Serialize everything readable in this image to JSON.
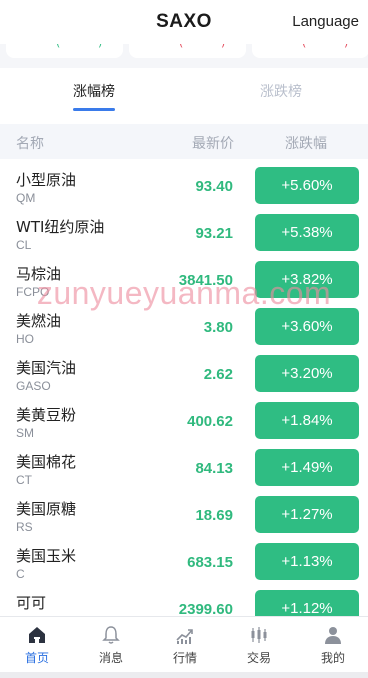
{
  "header": {
    "brand": "SAXO",
    "language_label": "Language"
  },
  "top_cards": [
    {
      "mark": "(",
      "mark_end": ")",
      "color": "#2fbd83"
    },
    {
      "mark": "(",
      "mark_end": ")",
      "color": "#e44b5c"
    },
    {
      "mark": "(",
      "mark_end": ")",
      "color": "#e44b5c"
    }
  ],
  "tabs": [
    {
      "label": "涨幅榜",
      "active": true
    },
    {
      "label": "涨跌榜",
      "active": false
    }
  ],
  "table": {
    "columns": {
      "name": "名称",
      "price": "最新价",
      "change": "涨跌幅"
    },
    "rows": [
      {
        "name": "小型原油",
        "code": "QM",
        "price": "93.40",
        "change": "+5.60%"
      },
      {
        "name": "WTI纽约原油",
        "code": "CL",
        "price": "93.21",
        "change": "+5.38%"
      },
      {
        "name": "马棕油",
        "code": "FCPO",
        "price": "3841.50",
        "change": "+3.82%"
      },
      {
        "name": "美燃油",
        "code": "HO",
        "price": "3.80",
        "change": "+3.60%"
      },
      {
        "name": "美国汽油",
        "code": "GASO",
        "price": "2.62",
        "change": "+3.20%"
      },
      {
        "name": "美黄豆粉",
        "code": "SM",
        "price": "400.62",
        "change": "+1.84%"
      },
      {
        "name": "美国棉花",
        "code": "CT",
        "price": "84.13",
        "change": "+1.49%"
      },
      {
        "name": "美国原糖",
        "code": "RS",
        "price": "18.69",
        "change": "+1.27%"
      },
      {
        "name": "美国玉米",
        "code": "C",
        "price": "683.15",
        "change": "+1.13%"
      },
      {
        "name": "可可",
        "code": "",
        "price": "2399.60",
        "change": "+1.12%"
      }
    ]
  },
  "watermark": "zunyueyuanma.com",
  "bottom_nav": [
    {
      "label": "首页",
      "icon": "home-icon",
      "active": true
    },
    {
      "label": "消息",
      "icon": "bell-icon",
      "active": false
    },
    {
      "label": "行情",
      "icon": "chart-icon",
      "active": false
    },
    {
      "label": "交易",
      "icon": "candlestick-icon",
      "active": false
    },
    {
      "label": "我的",
      "icon": "user-icon",
      "active": false
    }
  ],
  "colors": {
    "accent": "#2a6fe0",
    "up_green": "#2fbd83",
    "price_green": "#30b97e"
  }
}
